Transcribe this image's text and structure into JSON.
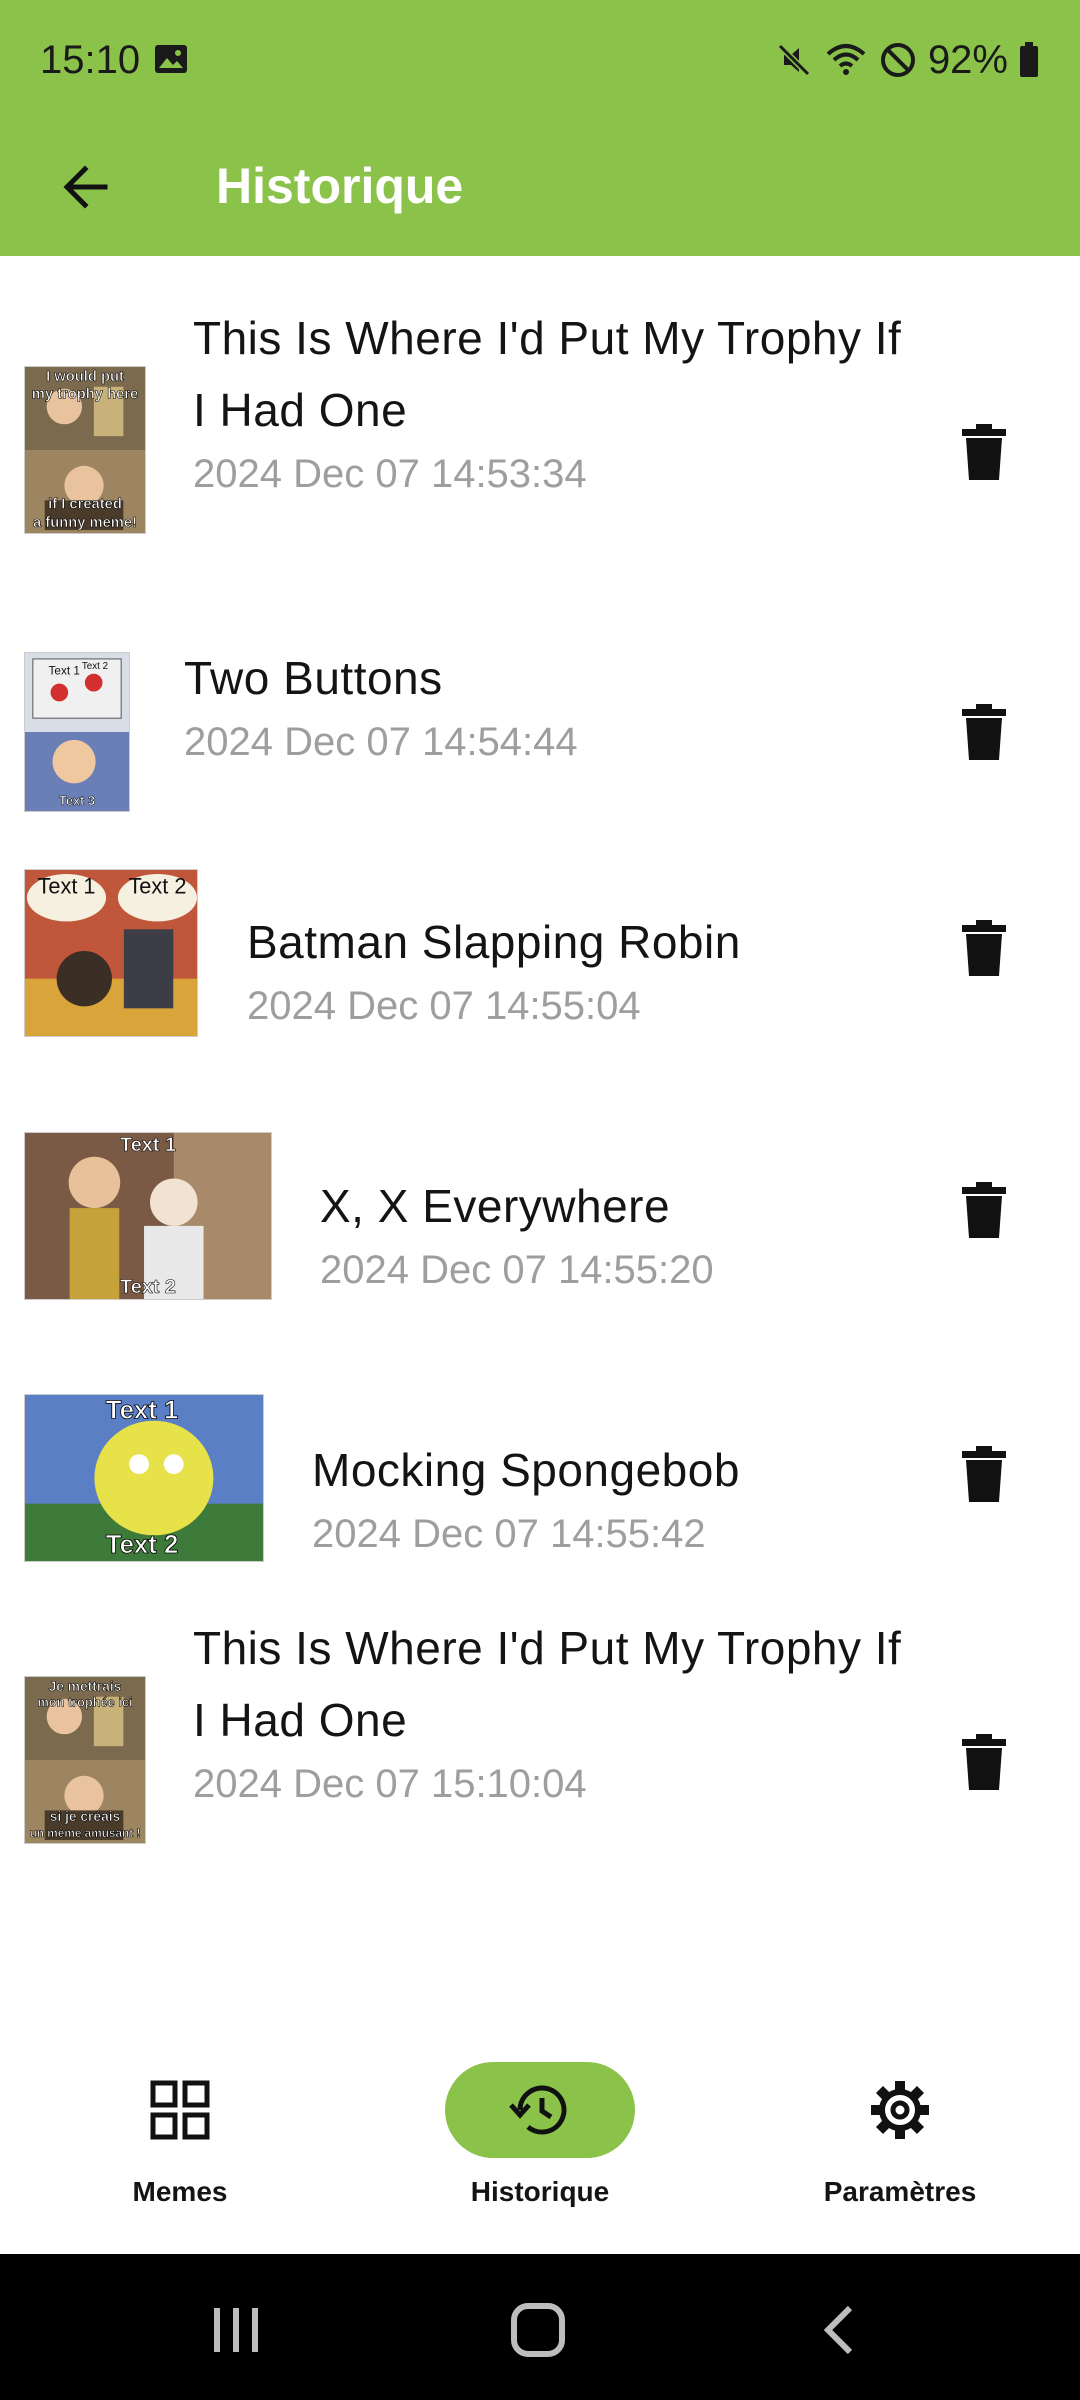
{
  "status_bar": {
    "time": "15:10",
    "battery": "92%",
    "icons": [
      "gallery-icon",
      "mute-icon",
      "wifi-icon",
      "do-not-disturb-icon",
      "battery-icon"
    ]
  },
  "toolbar": {
    "title": "Historique",
    "back_icon": "arrow-back-icon"
  },
  "history": [
    {
      "name": "This Is Where I'd Put My Trophy If I Had One",
      "date": "2024 Dec 07 14:53:34",
      "thumb_text": [
        "I would put",
        "my trophy here",
        "if I created",
        "a funny meme!"
      ]
    },
    {
      "name": "Two Buttons",
      "date": "2024 Dec 07 14:54:44",
      "thumb_text": [
        "Text 1",
        "Text 2",
        "Text 3"
      ]
    },
    {
      "name": "Batman Slapping Robin",
      "date": "2024 Dec 07 14:55:04",
      "thumb_text": [
        "Text 1",
        "Text 2"
      ]
    },
    {
      "name": "X, X Everywhere",
      "date": "2024 Dec 07 14:55:20",
      "thumb_text": [
        "Text 1",
        "Text 2"
      ]
    },
    {
      "name": "Mocking Spongebob",
      "date": "2024 Dec 07 14:55:42",
      "thumb_text": [
        "Text 1",
        "Text 2"
      ]
    },
    {
      "name": "This Is Where I'd Put My Trophy If I Had One",
      "date": "2024 Dec 07 15:10:04",
      "thumb_text": [
        "Je mettrais",
        "mon trophée ici",
        "si je créais",
        "un mème amusant !"
      ]
    }
  ],
  "bottom_nav": {
    "items": [
      {
        "label": "Memes",
        "icon": "grid-icon",
        "active": false
      },
      {
        "label": "Historique",
        "icon": "history-icon",
        "active": true
      },
      {
        "label": "Paramètres",
        "icon": "gear-icon",
        "active": false
      }
    ]
  },
  "colors": {
    "accent": "#8bc34a",
    "title_text": "#ffffff",
    "date_text": "#9e9e9e",
    "system_bar": "#000000"
  }
}
